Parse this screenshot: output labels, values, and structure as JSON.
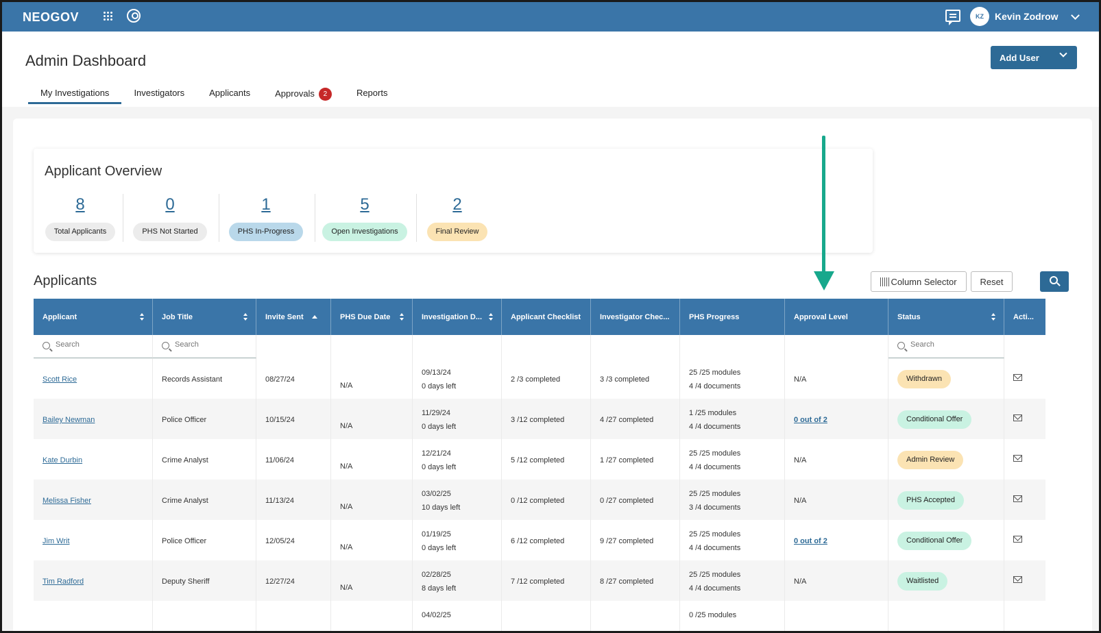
{
  "app": {
    "brand": "NEOGOV",
    "user_initials": "KZ",
    "user_name": "Kevin Zodrow"
  },
  "header": {
    "title": "Admin Dashboard",
    "add_user_label": "Add User",
    "tabs": [
      {
        "label": "My Investigations",
        "active": true
      },
      {
        "label": "Investigators"
      },
      {
        "label": "Applicants"
      },
      {
        "label": "Approvals",
        "badge": "2"
      },
      {
        "label": "Reports"
      }
    ]
  },
  "overview": {
    "title": "Applicant Overview",
    "stats": [
      {
        "value": "8",
        "label": "Total Applicants",
        "color": "#ececec"
      },
      {
        "value": "0",
        "label": "PHS Not Started",
        "color": "#ececec"
      },
      {
        "value": "1",
        "label": "PHS In-Progress",
        "color": "#b9d8ea"
      },
      {
        "value": "5",
        "label": "Open Investigations",
        "color": "#c9f2e2"
      },
      {
        "value": "2",
        "label": "Final Review",
        "color": "#fbe3b3"
      }
    ]
  },
  "applicants": {
    "title": "Applicants",
    "column_selector_label": "Column Selector",
    "reset_label": "Reset",
    "search_placeholder": "Search",
    "columns": [
      "Applicant",
      "Job Title",
      "Invite Sent",
      "PHS Due Date",
      "Investigation D...",
      "Applicant Checklist",
      "Investigator Chec...",
      "PHS Progress",
      "Approval Level",
      "Status",
      "Acti..."
    ],
    "rows": [
      {
        "name": "Scott Rice",
        "job": "Records Assistant",
        "invite": "08/27/24",
        "due": "N/A",
        "inv_date": "09/13/24",
        "inv_left": "0 days left",
        "app_check": "2 /3 completed",
        "inv_check": "3 /3 completed",
        "modules": "25 /25 modules",
        "docs": "4 /4 documents",
        "approval": "N/A",
        "status": "Withdrawn"
      },
      {
        "name": "Bailey Newman",
        "job": "Police Officer",
        "invite": "10/15/24",
        "due": "N/A",
        "inv_date": "11/29/24",
        "inv_left": "0 days left",
        "app_check": "3 /12 completed",
        "inv_check": "4 /27 completed",
        "modules": "1 /25 modules",
        "docs": "4 /4 documents",
        "approval": "0 out of 2",
        "status": "Conditional Offer"
      },
      {
        "name": "Kate Durbin",
        "job": "Crime Analyst",
        "invite": "11/06/24",
        "due": "N/A",
        "inv_date": "12/21/24",
        "inv_left": "0 days left",
        "app_check": "5 /12 completed",
        "inv_check": "1 /27 completed",
        "modules": "25 /25 modules",
        "docs": "4 /4 documents",
        "approval": "N/A",
        "status": "Admin Review"
      },
      {
        "name": "Melissa Fisher",
        "job": "Crime Analyst",
        "invite": "11/13/24",
        "due": "N/A",
        "inv_date": "03/02/25",
        "inv_left": "10 days left",
        "app_check": "0 /12 completed",
        "inv_check": "0 /27 completed",
        "modules": "25 /25 modules",
        "docs": "3 /4 documents",
        "approval": "N/A",
        "status": "PHS Accepted"
      },
      {
        "name": "Jim Writ",
        "job": "Police Officer",
        "invite": "12/05/24",
        "due": "N/A",
        "inv_date": "01/19/25",
        "inv_left": "0 days left",
        "app_check": "6 /12 completed",
        "inv_check": "9 /27 completed",
        "modules": "25 /25 modules",
        "docs": "4 /4 documents",
        "approval": "0 out of 2",
        "status": "Conditional Offer"
      },
      {
        "name": "Tim Radford",
        "job": "Deputy Sheriff",
        "invite": "12/27/24",
        "due": "N/A",
        "inv_date": "02/28/25",
        "inv_left": "8 days left",
        "app_check": "7 /12 completed",
        "inv_check": "8 /27 completed",
        "modules": "25 /25 modules",
        "docs": "4 /4 documents",
        "approval": "N/A",
        "status": "Waitlisted"
      },
      {
        "name": "",
        "job": "",
        "invite": "",
        "due": "",
        "inv_date": "04/02/25",
        "inv_left": "",
        "app_check": "",
        "inv_check": "",
        "modules": "0 /25 modules",
        "docs": "",
        "approval": "",
        "status": ""
      }
    ]
  },
  "status_colors": {
    "Withdrawn": "#fbe3b3",
    "Conditional Offer": "#c9f2e2",
    "Admin Review": "#fbe3b3",
    "PHS Accepted": "#c9f2e2",
    "Waitlisted": "#c9f2e2",
    "": "#b9d8ea"
  },
  "accent_color": "#3a75a8",
  "annotation_arrow_color": "#17a88c"
}
